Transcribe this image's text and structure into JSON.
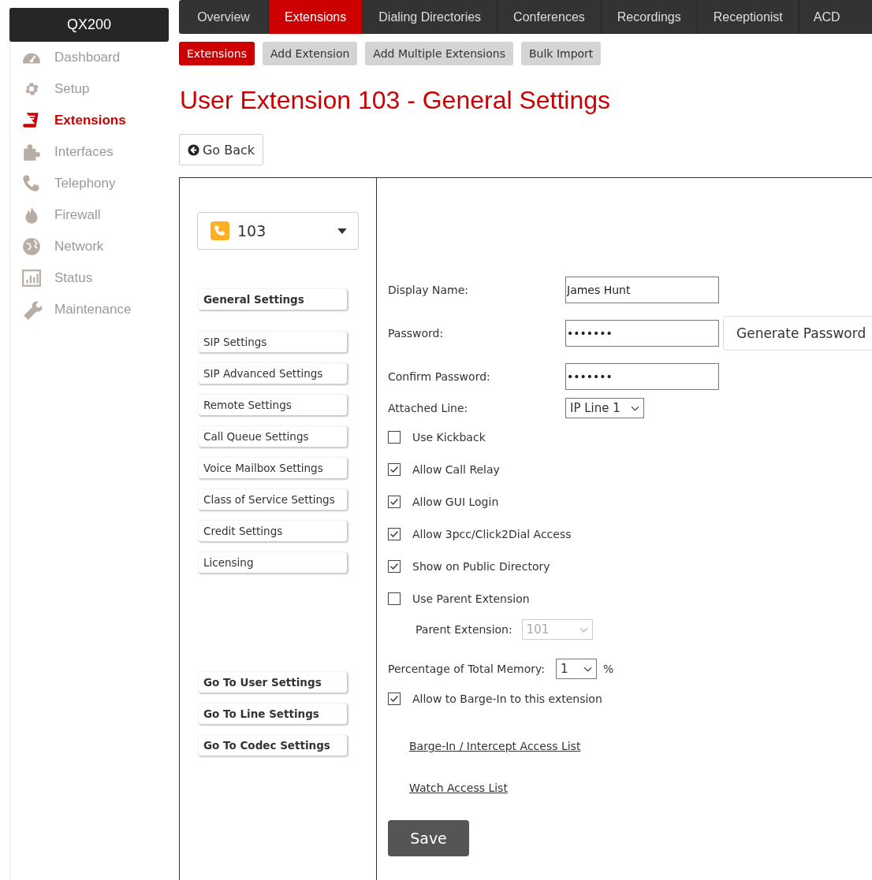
{
  "sidebar": {
    "title": "QX200",
    "items": [
      {
        "label": "Dashboard",
        "selected": false
      },
      {
        "label": "Setup",
        "selected": false
      },
      {
        "label": "Extensions",
        "selected": true
      },
      {
        "label": "Interfaces",
        "selected": false
      },
      {
        "label": "Telephony",
        "selected": false
      },
      {
        "label": "Firewall",
        "selected": false
      },
      {
        "label": "Network",
        "selected": false
      },
      {
        "label": "Status",
        "selected": false
      },
      {
        "label": "Maintenance",
        "selected": false
      }
    ]
  },
  "tabs": [
    {
      "label": "Overview",
      "selected": false
    },
    {
      "label": "Extensions",
      "selected": true
    },
    {
      "label": "Dialing Directories",
      "selected": false
    },
    {
      "label": "Conferences",
      "selected": false
    },
    {
      "label": "Recordings",
      "selected": false
    },
    {
      "label": "Receptionist",
      "selected": false
    },
    {
      "label": "ACD",
      "selected": false
    }
  ],
  "subtabs": [
    {
      "label": "Extensions",
      "selected": true
    },
    {
      "label": "Add Extension",
      "selected": false
    },
    {
      "label": "Add Multiple Extensions",
      "selected": false
    },
    {
      "label": "Bulk Import",
      "selected": false
    }
  ],
  "page_title": "User Extension 103 - General Settings",
  "back_button": "Go Back",
  "extension_select": {
    "value": "103"
  },
  "settings_menu": [
    {
      "label": "General Settings",
      "selected": true
    },
    {
      "label": "SIP Settings",
      "selected": false
    },
    {
      "label": "SIP Advanced Settings",
      "selected": false
    },
    {
      "label": "Remote Settings",
      "selected": false
    },
    {
      "label": "Call Queue Settings",
      "selected": false
    },
    {
      "label": "Voice Mailbox Settings",
      "selected": false
    },
    {
      "label": "Class of Service Settings",
      "selected": false
    },
    {
      "label": "Credit Settings",
      "selected": false
    },
    {
      "label": "Licensing",
      "selected": false
    }
  ],
  "goto_buttons": [
    "Go To User Settings",
    "Go To Line Settings",
    "Go To Codec Settings"
  ],
  "form": [
    {
      "kind": "text",
      "label": "Display Name:",
      "value": "James Hunt"
    },
    {
      "kind": "text",
      "label": "Password:",
      "value": "•••••••",
      "button": "Generate Password"
    },
    {
      "kind": "text",
      "label": "Confirm Password:",
      "value": "•••••••"
    },
    {
      "kind": "select",
      "label": "Attached Line:",
      "value": "IP Line 1"
    },
    {
      "kind": "checkbox",
      "label": "Use Kickback",
      "checked": false
    },
    {
      "kind": "checkbox",
      "label": "Allow Call Relay",
      "checked": true
    },
    {
      "kind": "checkbox",
      "label": "Allow GUI Login",
      "checked": true
    },
    {
      "kind": "checkbox",
      "label": "Allow 3pcc/Click2Dial Access",
      "checked": true
    },
    {
      "kind": "checkbox",
      "label": "Show on Public Directory",
      "checked": true
    },
    {
      "kind": "checkbox",
      "label": "Use Parent Extension",
      "checked": false
    },
    {
      "kind": "subselect",
      "label": "Parent Extension:",
      "value": "101",
      "disabled": true
    },
    {
      "kind": "memory",
      "label": "Percentage of Total Memory:",
      "value": "1",
      "suffix": "%"
    },
    {
      "kind": "checkbox",
      "label": "Allow to Barge-In to this extension",
      "checked": true
    },
    {
      "kind": "link",
      "label": "Barge-In / Intercept Access List"
    },
    {
      "kind": "link",
      "label": "Watch Access List"
    }
  ],
  "save_button": "Save"
}
